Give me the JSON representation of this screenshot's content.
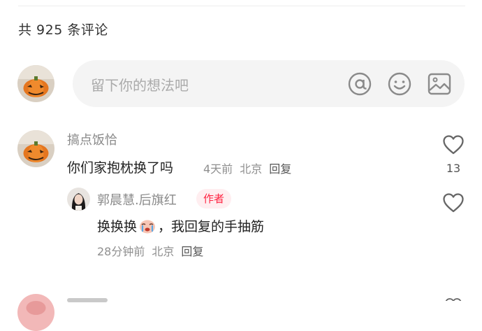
{
  "comments_header": {
    "count_label": "共 925 条评论"
  },
  "composer": {
    "placeholder": "留下你的想法吧",
    "icons": [
      "at-icon",
      "emoji-icon",
      "image-icon"
    ]
  },
  "comments": [
    {
      "username": "搞点饭恰",
      "text": "你们家抱枕换了吗",
      "time": "4天前",
      "location": "北京",
      "reply_label": "回复",
      "like_count": "13",
      "reply": {
        "username": "郭晨慧.后旗红",
        "badge": "作者",
        "text_before": "换换换",
        "text_after": "，我回复的手抽筋",
        "time": "28分钟前",
        "location": "北京",
        "reply_label": "回复"
      }
    }
  ],
  "colors": {
    "accent": "#ff2442",
    "badge_bg": "#ffeef0",
    "input_bg": "#f4f4f4",
    "muted_text": "#8f8f8f"
  }
}
